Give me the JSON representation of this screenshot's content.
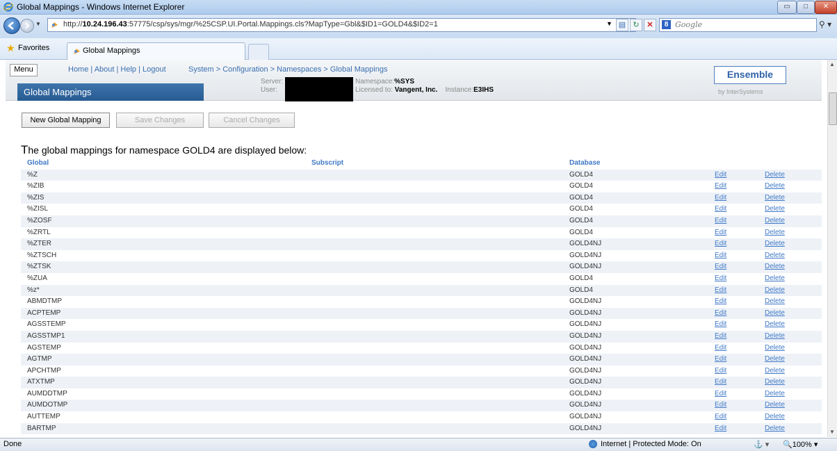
{
  "window": {
    "title": "Global Mappings - Windows Internet Explorer",
    "controls": {
      "minimize": "▭",
      "maximize": "□",
      "close": "✕"
    }
  },
  "addressbar": {
    "url_pre": "http://",
    "url_host": "10.24.196.43",
    "url_post": ":57775/csp/sys/mgr/%25CSP.UI.Portal.Mappings.cls?MapType=Gbl&$ID1=GOLD4&$ID2=1",
    "search_placeholder": "Google",
    "google_letter": "8"
  },
  "favorites": {
    "label": "Favorites",
    "tab_label": "Global Mappings"
  },
  "header": {
    "menu_label": "Menu",
    "links": "Home | About | Help | Logout",
    "breadcrumb": "System > Configuration > Namespaces > Global Mappings",
    "page_title": "Global Mappings",
    "server_label": "Server:",
    "user_label": "User:",
    "namespace_label": "Namespace:",
    "namespace_value": "%SYS",
    "licensed_label": "Licensed to:",
    "licensed_value": "Vangent, Inc.",
    "instance_label": "Instance:",
    "instance_value": "E3IHS",
    "brand": "Ensemble",
    "brand_sub": "by InterSystems"
  },
  "buttons": {
    "new": "New Global Mapping",
    "save": "Save Changes",
    "cancel": "Cancel Changes"
  },
  "description": {
    "first_letter": "T",
    "rest": "he global mappings for namespace GOLD4 are displayed below:"
  },
  "table": {
    "columns": {
      "global": "Global",
      "subscript": "Subscript",
      "database": "Database"
    },
    "edit_label": "Edit",
    "delete_label": "Delete",
    "rows": [
      {
        "global": "%Z",
        "database": "GOLD4"
      },
      {
        "global": "%ZIB",
        "database": "GOLD4"
      },
      {
        "global": "%ZIS",
        "database": "GOLD4"
      },
      {
        "global": "%ZISL",
        "database": "GOLD4"
      },
      {
        "global": "%ZOSF",
        "database": "GOLD4"
      },
      {
        "global": "%ZRTL",
        "database": "GOLD4"
      },
      {
        "global": "%ZTER",
        "database": "GOLD4NJ"
      },
      {
        "global": "%ZTSCH",
        "database": "GOLD4NJ"
      },
      {
        "global": "%ZTSK",
        "database": "GOLD4NJ"
      },
      {
        "global": "%ZUA",
        "database": "GOLD4"
      },
      {
        "global": "%z*",
        "database": "GOLD4"
      },
      {
        "global": "ABMDTMP",
        "database": "GOLD4NJ"
      },
      {
        "global": "ACPTEMP",
        "database": "GOLD4NJ"
      },
      {
        "global": "AGSSTEMP",
        "database": "GOLD4NJ"
      },
      {
        "global": "AGSSTMP1",
        "database": "GOLD4NJ"
      },
      {
        "global": "AGSTEMP",
        "database": "GOLD4NJ"
      },
      {
        "global": "AGTMP",
        "database": "GOLD4NJ"
      },
      {
        "global": "APCHTMP",
        "database": "GOLD4NJ"
      },
      {
        "global": "ATXTMP",
        "database": "GOLD4NJ"
      },
      {
        "global": "AUMDDTMP",
        "database": "GOLD4NJ"
      },
      {
        "global": "AUMDOTMP",
        "database": "GOLD4NJ"
      },
      {
        "global": "AUTTEMP",
        "database": "GOLD4NJ"
      },
      {
        "global": "BARTMP",
        "database": "GOLD4NJ"
      }
    ]
  },
  "statusbar": {
    "done": "Done",
    "zone": "Internet | Protected Mode: On",
    "protect": "⚓ ▾",
    "zoom": "🔍100% ▾"
  }
}
